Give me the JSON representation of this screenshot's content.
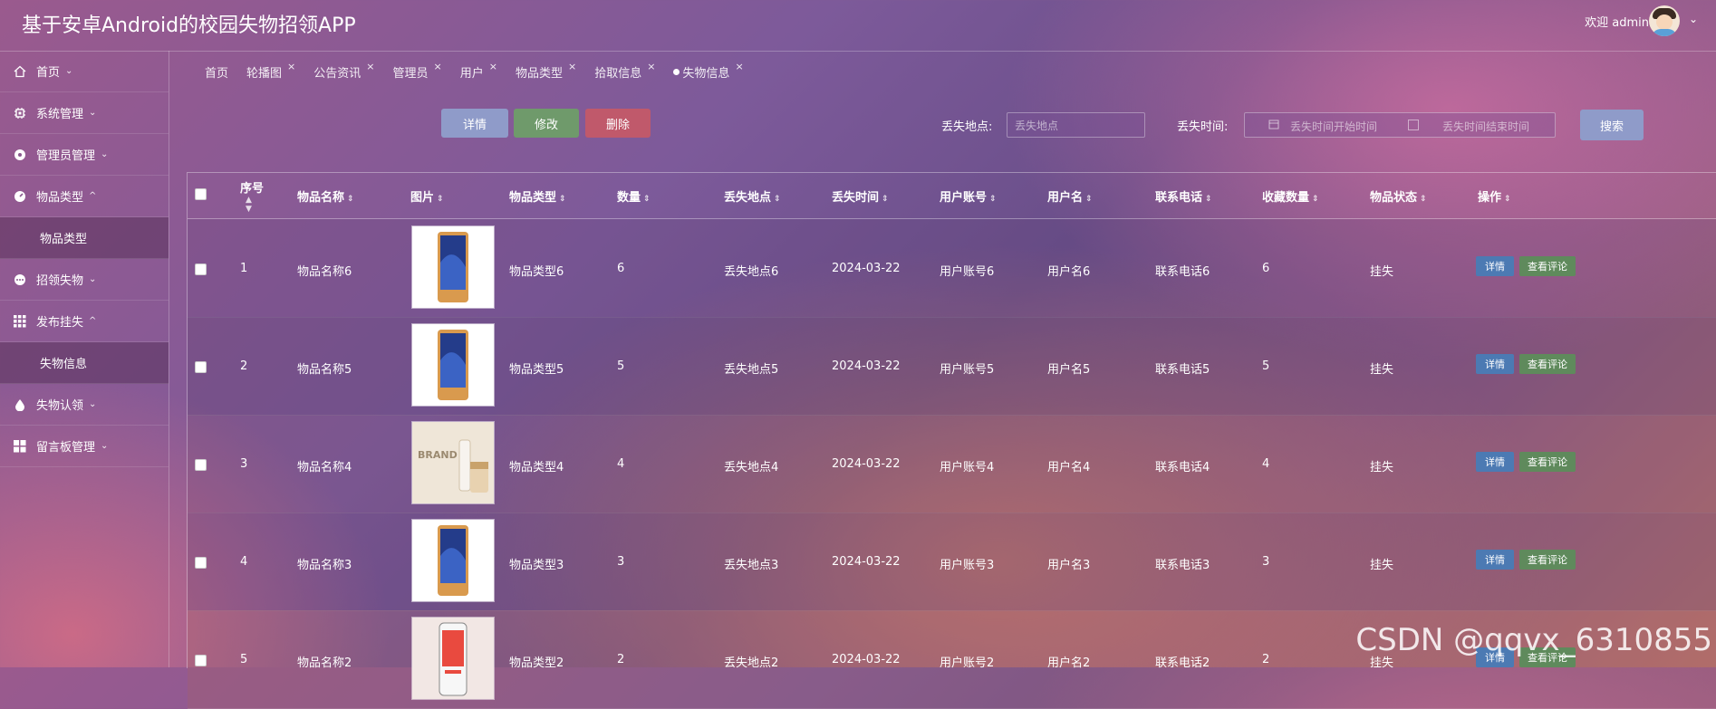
{
  "header": {
    "title": "基于安卓Android的校园失物招领APP",
    "welcome": "欢迎 admin",
    "caret": "⌄"
  },
  "sidebar": {
    "items": [
      {
        "label": "首页",
        "icon": "home-icon",
        "caret": "⌄"
      },
      {
        "label": "系统管理",
        "icon": "cpu-icon",
        "caret": "⌄"
      },
      {
        "label": "管理员管理",
        "icon": "circle-dot-icon",
        "caret": "⌄"
      },
      {
        "label": "物品类型",
        "icon": "gauge-icon",
        "caret": "^",
        "sub": "物品类型"
      },
      {
        "label": "招领失物",
        "icon": "more-icon",
        "caret": "⌄"
      },
      {
        "label": "发布挂失",
        "icon": "grid-icon",
        "caret": "^",
        "sub": "失物信息"
      },
      {
        "label": "失物认领",
        "icon": "drop-icon",
        "caret": "⌄"
      },
      {
        "label": "留言板管理",
        "icon": "grid-icon",
        "caret": "⌄"
      }
    ]
  },
  "tabs": [
    {
      "label": "首页"
    },
    {
      "label": "轮播图",
      "close": "×"
    },
    {
      "label": "公告资讯",
      "close": "×"
    },
    {
      "label": "管理员",
      "close": "×"
    },
    {
      "label": "用户",
      "close": "×"
    },
    {
      "label": "物品类型",
      "close": "×"
    },
    {
      "label": "拾取信息",
      "close": "×"
    },
    {
      "label": "失物信息",
      "close": "×",
      "active": true
    }
  ],
  "toolbar": {
    "detail": "详情",
    "edit": "修改",
    "delete": "删除"
  },
  "search": {
    "location_label": "丢失地点:",
    "location_placeholder": "丢失地点",
    "time_label": "丢失时间:",
    "start_placeholder": "丢失时间开始时间",
    "end_placeholder": "丢失时间结束时间",
    "search_button": "搜索"
  },
  "table": {
    "columns": [
      "序号",
      "物品名称",
      "图片",
      "物品类型",
      "数量",
      "丢失地点",
      "丢失时间",
      "用户账号",
      "用户名",
      "联系电话",
      "收藏数量",
      "物品状态",
      "操作"
    ],
    "rows": [
      {
        "no": "1",
        "name": "物品名称6",
        "img": "phone",
        "type": "物品类型6",
        "qty": "6",
        "place": "丢失地点6",
        "time": "2024-03-22",
        "account": "用户账号6",
        "user": "用户名6",
        "phone": "联系电话6",
        "fav": "6",
        "status": "挂失"
      },
      {
        "no": "2",
        "name": "物品名称5",
        "img": "phone",
        "type": "物品类型5",
        "qty": "5",
        "place": "丢失地点5",
        "time": "2024-03-22",
        "account": "用户账号5",
        "user": "用户名5",
        "phone": "联系电话5",
        "fav": "5",
        "status": "挂失"
      },
      {
        "no": "3",
        "name": "物品名称4",
        "img": "cosmetic",
        "type": "物品类型4",
        "qty": "4",
        "place": "丢失地点4",
        "time": "2024-03-22",
        "account": "用户账号4",
        "user": "用户名4",
        "phone": "联系电话4",
        "fav": "4",
        "status": "挂失"
      },
      {
        "no": "4",
        "name": "物品名称3",
        "img": "phone",
        "type": "物品类型3",
        "qty": "3",
        "place": "丢失地点3",
        "time": "2024-03-22",
        "account": "用户账号3",
        "user": "用户名3",
        "phone": "联系电话3",
        "fav": "3",
        "status": "挂失"
      },
      {
        "no": "5",
        "name": "物品名称2",
        "img": "phone2",
        "type": "物品类型2",
        "qty": "2",
        "place": "丢失地点2",
        "time": "2024-03-22",
        "account": "用户账号2",
        "user": "用户名2",
        "phone": "联系电话2",
        "fav": "2",
        "status": "挂失"
      }
    ],
    "action_detail": "详情",
    "action_comment": "查看评论"
  },
  "image_text": {
    "cosmetic_brand": "BRAND"
  },
  "watermark": "CSDN @qqvx_6310855"
}
